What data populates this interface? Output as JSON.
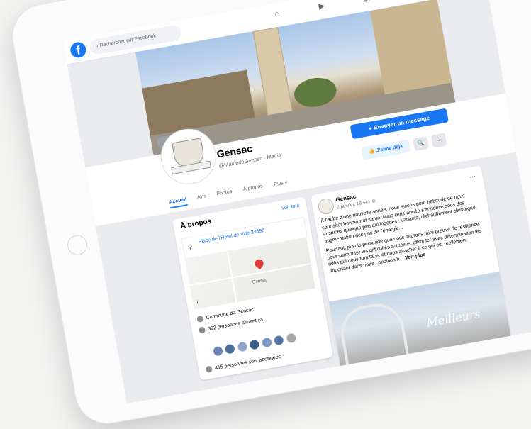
{
  "topbar": {
    "logo": "f",
    "search_placeholder": "Rechercher sur Facebook",
    "icons": [
      "home-icon",
      "video-icon",
      "marketplace-icon",
      "groups-icon",
      "menu-icon"
    ]
  },
  "page": {
    "name": "Gensac",
    "subtitle": "@MairiedeGensac · Mairie",
    "message_button": "Envoyer un message",
    "like_button": "J'aime déjà",
    "search_button": "🔍",
    "more_button": "···"
  },
  "tabs": [
    "Accueil",
    "Avis",
    "Photos",
    "À propos",
    "Plus ▾"
  ],
  "about": {
    "title": "À propos",
    "see_all": "Voir tout",
    "address": "Place de l'Hôtel de Ville 33890",
    "map_label": "Gensac",
    "map_dot": "i",
    "community": "Commune de Gensac",
    "likes": "392 personnes aiment ça",
    "followers": "415 personnes sont abonnées"
  },
  "post": {
    "author": "Gensac",
    "date": "2 janvier, 18:54 · ⊘",
    "more": "···",
    "paragraph1": "À l'aube d'une nouvelle année, nous avions pour habitude de nous souhaiter bonheur et santé. Mais cette année s'annonce sous des auspices quelque peu anxiogènes : variants, réchauffement climatique, augmentation des prix de l'énergie...",
    "paragraph2": "Pourtant, je suis persuadé que nous saurons faire preuve de résilience pour surmonter les difficultés actuelles, affronter avec détermination les défis qui nous font face, et nous attacher à ce qui est réellement important dans notre condition h...",
    "see_more": "Voir plus",
    "image_text": "Meilleurs"
  }
}
